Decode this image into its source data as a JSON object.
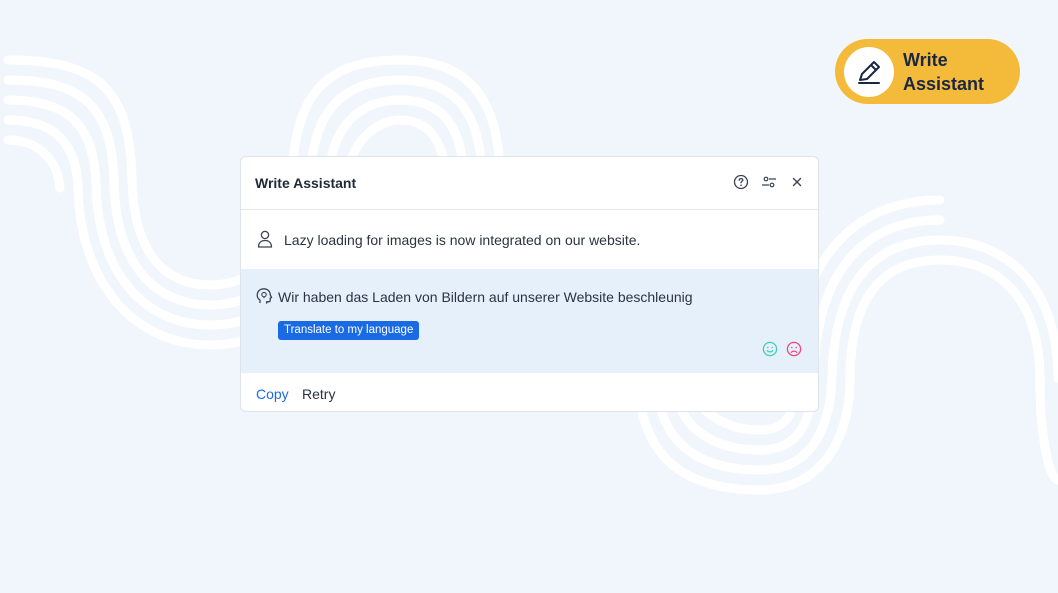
{
  "badge": {
    "line1": "Write",
    "line2": "Assistant",
    "icon": "pen-icon"
  },
  "panel": {
    "title": "Write Assistant",
    "header_icons": [
      "help-icon",
      "settings-sliders-icon",
      "close-icon"
    ],
    "user_message": "Lazy loading for images is now integrated on our website.",
    "assistant_message": "Wir haben das Laden von Bildern auf unserer Website beschleunig",
    "suggestion_tag": "Translate to my language",
    "footer": {
      "copy_label": "Copy",
      "retry_label": "Retry"
    }
  },
  "colors": {
    "background": "#f1f6fd",
    "badge": "#f3bb39",
    "accent": "#1a6ae6",
    "assistant_bg": "#e6f0fb",
    "happy": "#3fcfb6",
    "sad": "#f0457a"
  }
}
